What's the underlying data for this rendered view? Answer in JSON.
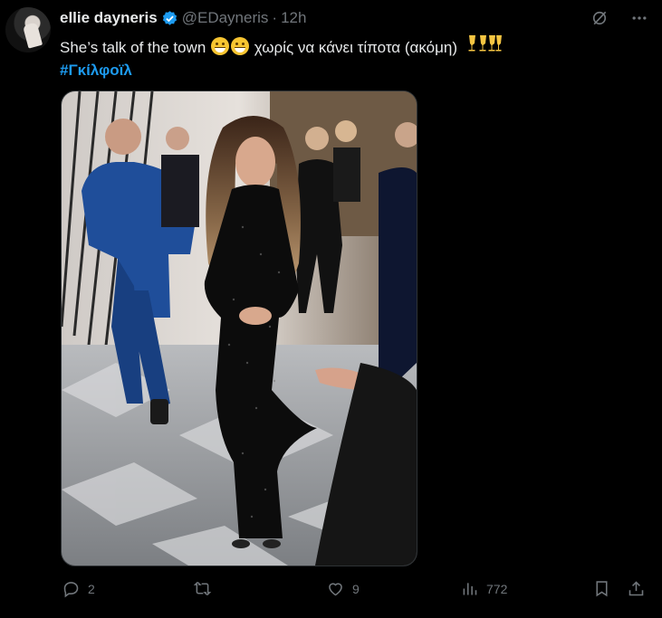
{
  "author": {
    "name": "ellie dayneris",
    "handle": "@EDayneris",
    "separator": "·",
    "time": "12h"
  },
  "tweet": {
    "line1_text": "She’s talk of the town",
    "line1_greek": "χωρίς να κάνει τίποτα (ακόμη)",
    "emoji": [
      "grinning-face-with-smiling-eyes",
      "grinning-face-with-smiling-eyes",
      "clinking-glasses",
      "clinking-glasses"
    ],
    "hashtag": "#Γκίλφοϊλ"
  },
  "media": {
    "description_icon": "photo",
    "colors": {
      "dress": "#0d0d0d",
      "suit": "#1f4e9a",
      "floor": "#8c8f93"
    }
  },
  "metrics": {
    "replies": "2",
    "reposts": "",
    "likes": "9",
    "views": "772"
  },
  "colors": {
    "background": "#000000",
    "text": "#e7e9ea",
    "muted": "#71767b",
    "accent": "#1d9bf0"
  }
}
